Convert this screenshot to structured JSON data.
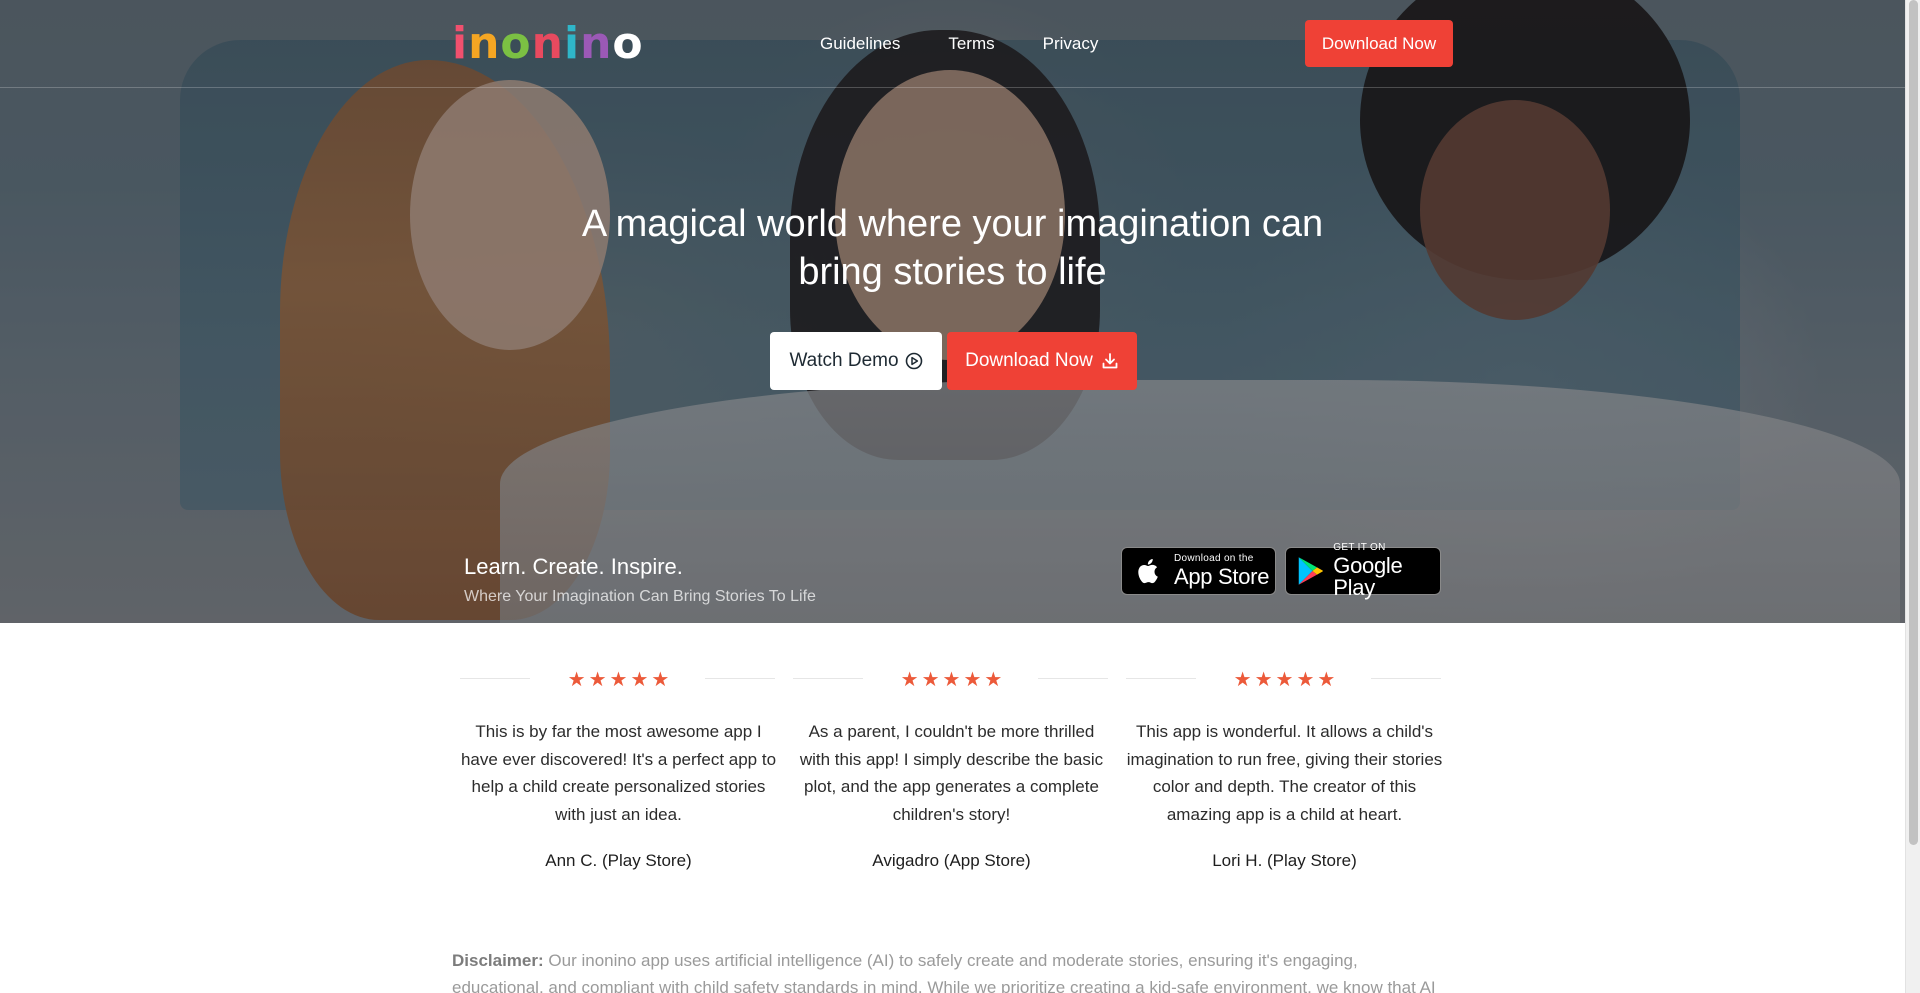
{
  "nav": {
    "logo_text": "inonino",
    "links": [
      "Guidelines",
      "Terms",
      "Privacy"
    ],
    "download_label": "Download Now"
  },
  "hero": {
    "headline": "A magical world where your imagination can bring stories to life",
    "watch_demo_label": "Watch Demo",
    "download_label": "Download Now",
    "tagline": "Learn. Create. Inspire.",
    "subtagline": "Where Your Imagination Can Bring Stories To Life",
    "app_store": {
      "small": "Download on the",
      "big": "App Store"
    },
    "google_play": {
      "small": "GET IT ON",
      "big": "Google Play"
    }
  },
  "reviews": [
    {
      "stars": 5,
      "text": "This is by far the most awesome app I have ever discovered! It's a perfect app to help a child create personalized stories with just an idea.",
      "author": "Ann C. (Play Store)"
    },
    {
      "stars": 5,
      "text": "As a parent, I couldn't be more thrilled with this app! I simply describe the basic plot, and the app generates a complete children's story!",
      "author": "Avigadro (App Store)"
    },
    {
      "stars": 5,
      "text": "This app is wonderful. It allows a child's imagination to run free, giving their stories color and depth. The creator of this amazing app is a child at heart.",
      "author": "Lori H. (Play Store)"
    }
  ],
  "disclaimer": {
    "label": "Disclaimer:",
    "text": "Our inonino app uses artificial intelligence (AI) to safely create and moderate stories, ensuring it's engaging, educational, and compliant with child safety standards in mind. While we prioritize creating a kid-safe environment, we know that AI isn't perfect."
  },
  "colors": {
    "accent_red": "#ef4136",
    "star": "#ec5a3a"
  },
  "icons": {
    "watch_demo": "play-circle-icon",
    "download": "download-icon",
    "apple": "apple-icon",
    "google_play": "google-play-icon",
    "star": "star-icon"
  }
}
